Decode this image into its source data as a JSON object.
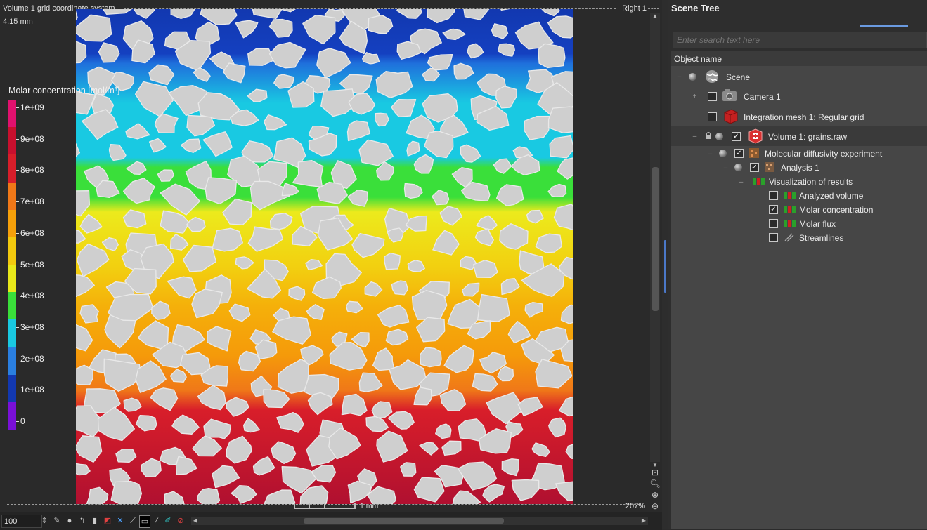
{
  "viewport": {
    "title": "Volume 1 grid coordinate system",
    "size": "4.15 mm",
    "view": "Right 1",
    "zoom_percent": "207%",
    "scale_label": "1 mm"
  },
  "legend": {
    "title": "Molar concentration [mol/m³]",
    "ticks": [
      "1e+09",
      "9e+08",
      "8e+08",
      "7e+08",
      "6e+08",
      "5e+08",
      "4e+08",
      "3e+08",
      "2e+08",
      "1e+08",
      "0"
    ],
    "colors": [
      "#e0116e",
      "#c8102e",
      "#d81e2a",
      "#f07818",
      "#f5a00a",
      "#f2c90e",
      "#e8e81a",
      "#3adf3a",
      "#19c9e2",
      "#2a7fe0",
      "#1238b0",
      "#7a10d8"
    ]
  },
  "bottom_bar": {
    "zoom_value": "100",
    "tools": [
      "spin-icon",
      "probe-icon",
      "circle-tool-icon",
      "rotate-icon",
      "clip-icon",
      "slice-icon",
      "axis-x-icon",
      "measure-icon",
      "ruler-icon",
      "pen-icon",
      "pencil-icon",
      "no-entry-icon"
    ]
  },
  "scene_tree": {
    "title": "Scene Tree",
    "search_placeholder": "Enter search text here",
    "column_header": "Object name",
    "items": [
      {
        "label": "Scene",
        "icon": "globe-icon"
      },
      {
        "label": "Camera 1",
        "icon": "camera-icon",
        "checked": false
      },
      {
        "label": "Integration mesh 1: Regular grid",
        "icon": "mesh-icon",
        "checked": false
      },
      {
        "label": "Volume 1: grains.raw",
        "icon": "volume-icon",
        "checked": true
      },
      {
        "label": "Molecular diffusivity experiment",
        "icon": "experiment-icon",
        "checked": true
      },
      {
        "label": "Analysis 1",
        "icon": "analysis-icon",
        "checked": true
      },
      {
        "label": "Visualization of results",
        "icon": "visualization-icon"
      },
      {
        "label": "Analyzed volume",
        "icon": "analyzed-volume-icon",
        "checked": false
      },
      {
        "label": "Molar concentration",
        "icon": "molar-concentration-icon",
        "checked": true
      },
      {
        "label": "Molar flux",
        "icon": "molar-flux-icon",
        "checked": false
      },
      {
        "label": "Streamlines",
        "icon": "streamlines-icon",
        "checked": false
      }
    ]
  }
}
